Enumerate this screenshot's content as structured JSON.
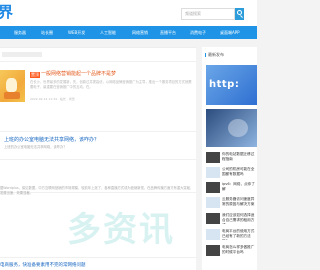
{
  "header": {
    "logo_text": "界",
    "search_placeholder": "频道搜索"
  },
  "nav": {
    "items": [
      "服务器",
      "站长圈",
      "WEB开发",
      "人工智能",
      "网络营销",
      "直播平台",
      "消费电子",
      "桌面端APP"
    ]
  },
  "main": {
    "posts": [
      {
        "badge": "置顶",
        "title": "一般网络营销能起一个品牌不是梦",
        "excerpt": "在长沙，世界最多的发展新，先，创新过并提高优，以网络品牌营销推广为主导，推出一个服务项目的方式就需要电子，最重要在营销推广中的互动，在。",
        "meta": "2022-02-12 11:34 · 站长 · 浏览"
      },
      {
        "title": "上班的办公室电脑无法共享网络，该咋办？",
        "excerpt": "上班的办公室电脑无法共享网络，该咋办？",
        "meta": ""
      },
      {
        "title": "",
        "excerpt": "据Wordplus，保见数据，中方互联网营销的市场规模，较前年上涨了，各种直播方式成为营销新宠，在品牌传播方面又有重大突破，发展迅速，效果显著。",
        "meta": ""
      }
    ],
    "bottom_title": "电商服务，快准备要素用不完的常网络问题"
  },
  "sidebar": {
    "heading": "最新发布",
    "banner_text": "http:",
    "items": [
      "你的电站数据迁移过程指南",
      "公司的机房可能在全国都有数据吗",
      "ipv6：网络，点你了解",
      "云服务器访问速度异常的原因与解决方案",
      "我们应该如何选择适合自己需求的租用方式",
      "电商平台的使用方式已经有了新的方法吗？",
      "电商怎么样多做推广的时候平台吗"
    ]
  },
  "watermark_text": "多资讯"
}
